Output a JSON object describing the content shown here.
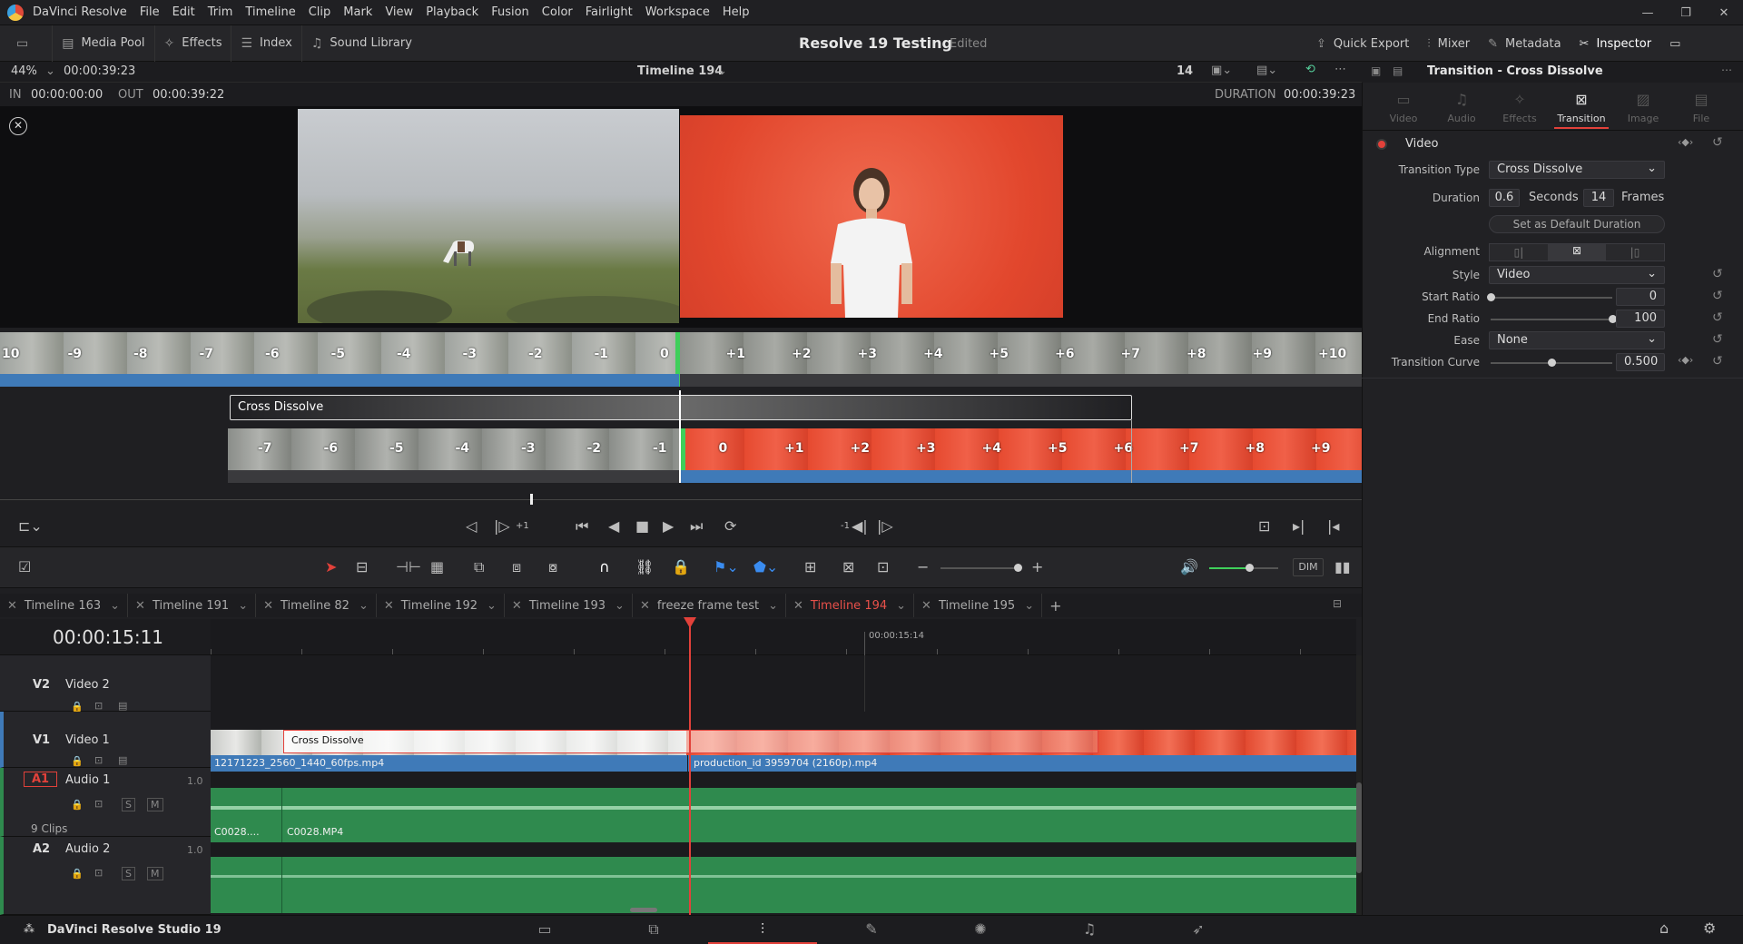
{
  "menubar": {
    "app": "DaVinci Resolve",
    "items": [
      "File",
      "Edit",
      "Trim",
      "Timeline",
      "Clip",
      "Mark",
      "View",
      "Playback",
      "Fusion",
      "Color",
      "Fairlight",
      "Workspace",
      "Help"
    ]
  },
  "toolbar": {
    "left": [
      "Media Pool",
      "Effects",
      "Index",
      "Sound Library"
    ],
    "project_title": "Resolve 19 Testing",
    "status": "Edited",
    "right": [
      "Quick Export",
      "Mixer",
      "Metadata",
      "Inspector"
    ]
  },
  "viewer": {
    "zoom": "44%",
    "timecode": "00:00:39:23",
    "timeline_name": "Timeline 194",
    "frame_count": "14",
    "in_label": "IN",
    "in_value": "00:00:00:00",
    "out_label": "OUT",
    "out_value": "00:00:39:22",
    "duration_label": "DURATION",
    "duration_value": "00:00:39:23"
  },
  "trim": {
    "top_labels": [
      "10",
      "-9",
      "-8",
      "-7",
      "-6",
      "-5",
      "-4",
      "-3",
      "-2",
      "-1",
      "0",
      "+1",
      "+2",
      "+3",
      "+4",
      "+5",
      "+6",
      "+7",
      "+8",
      "+9",
      "+10",
      "+1"
    ],
    "transition_label": "Cross Dissolve",
    "bottom_labels": [
      "-7",
      "-6",
      "-5",
      "-4",
      "-3",
      "-2",
      "-1",
      "0",
      "+1",
      "+2",
      "+3",
      "+4",
      "+5",
      "+6",
      "+7",
      "+8",
      "+9",
      "+1"
    ]
  },
  "transport": {
    "prev_marker": "-1",
    "next_marker": "+1"
  },
  "edit_toolbar": {
    "dim": "DIM"
  },
  "tabs": [
    "Timeline 163",
    "Timeline 191",
    "Timeline 82",
    "Timeline 192",
    "Timeline 193",
    "freeze frame test",
    "Timeline 194",
    "Timeline 195"
  ],
  "active_tab": "Timeline 194",
  "timeline": {
    "timecode": "00:00:15:11",
    "ruler_marker": "00:00:15:14",
    "clip_count": "9 Clips",
    "tracks": [
      {
        "id": "V2",
        "name": "Video 2"
      },
      {
        "id": "V1",
        "name": "Video 1"
      },
      {
        "id": "A1",
        "name": "Audio 1",
        "level": "1.0"
      },
      {
        "id": "A2",
        "name": "Audio 2",
        "level": "1.0"
      }
    ],
    "v1_transition": "Cross Dissolve",
    "v1_clip_a": "12171223_2560_1440_60fps.mp4",
    "v1_clip_b": "production_id 3959704 (2160p).mp4",
    "a1_clip_a": "C0028....",
    "a1_clip_b": "C0028.MP4",
    "solo": "S",
    "mute": "M"
  },
  "inspector": {
    "title": "Transition - Cross Dissolve",
    "tabs": [
      "Video",
      "Audio",
      "Effects",
      "Transition",
      "Image",
      "File"
    ],
    "active_tab": "Transition",
    "section": "Video",
    "fields": {
      "transition_type_label": "Transition Type",
      "transition_type": "Cross Dissolve",
      "duration_label": "Duration",
      "duration_seconds": "0.6",
      "seconds_label": "Seconds",
      "duration_frames": "14",
      "frames_label": "Frames",
      "default_button": "Set as Default Duration",
      "alignment_label": "Alignment",
      "style_label": "Style",
      "style": "Video",
      "start_ratio_label": "Start Ratio",
      "start_ratio": "0",
      "end_ratio_label": "End Ratio",
      "end_ratio": "100",
      "ease_label": "Ease",
      "ease": "None",
      "curve_label": "Transition Curve",
      "curve": "0.500"
    },
    "levels": {
      "start_ratio": 0,
      "end_ratio": 1.0,
      "transition_curve": 0.5
    }
  },
  "bottombar": {
    "app_name": "DaVinci Resolve Studio 19"
  },
  "colors": {
    "accent": "#e2413a",
    "clip_blue": "#3f7ab8",
    "audio_green": "#2f8a4e",
    "orange": "#e2472d"
  }
}
